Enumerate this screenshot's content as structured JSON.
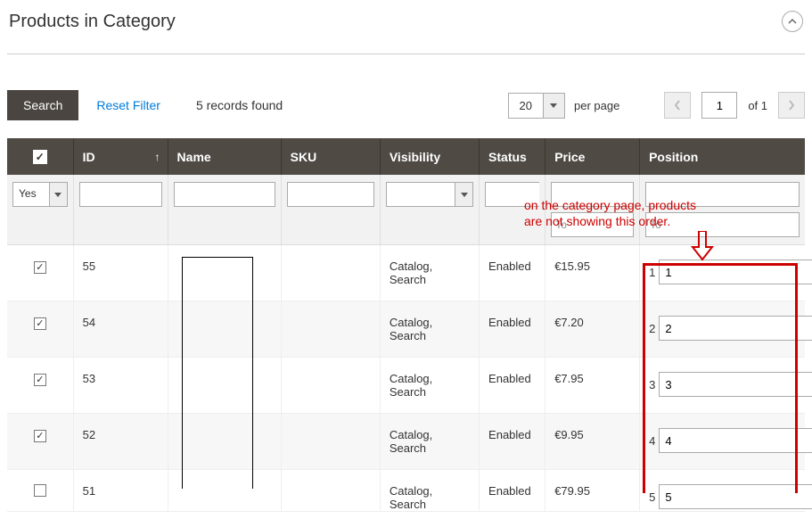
{
  "header": {
    "title": "Products in Category"
  },
  "toolbar": {
    "search_label": "Search",
    "reset_label": "Reset Filter",
    "records_found": "5 records found",
    "per_page_value": "20",
    "per_page_label": "per page",
    "page_current": "1",
    "page_of": "of 1"
  },
  "columns": {
    "id": "ID",
    "name": "Name",
    "sku": "SKU",
    "visibility": "Visibility",
    "status": "Status",
    "price": "Price",
    "position": "Position"
  },
  "filters": {
    "checkbox_select": "Yes",
    "price_to": "To",
    "position_to": "To"
  },
  "rows": [
    {
      "id": "55",
      "name": "",
      "sku": "",
      "visibility": "Catalog, Search",
      "status": "Enabled",
      "price": "€15.95",
      "pos_label": "1",
      "pos_value": "1"
    },
    {
      "id": "54",
      "name": "",
      "sku": "",
      "visibility": "Catalog, Search",
      "status": "Enabled",
      "price": "€7.20",
      "pos_label": "2",
      "pos_value": "2"
    },
    {
      "id": "53",
      "name": "",
      "sku": "",
      "visibility": "Catalog, Search",
      "status": "Enabled",
      "price": "€7.95",
      "pos_label": "3",
      "pos_value": "3"
    },
    {
      "id": "52",
      "name": "",
      "sku": "",
      "visibility": "Catalog, Search",
      "status": "Enabled",
      "price": "€9.95",
      "pos_label": "4",
      "pos_value": "4"
    },
    {
      "id": "51",
      "name": "",
      "sku": "",
      "visibility": "Catalog, Search",
      "status": "Enabled",
      "price": "€79.95",
      "pos_label": "5",
      "pos_value": "5"
    }
  ],
  "annotation": {
    "line1": "on the category page, products",
    "line2": "are not showing this order."
  }
}
